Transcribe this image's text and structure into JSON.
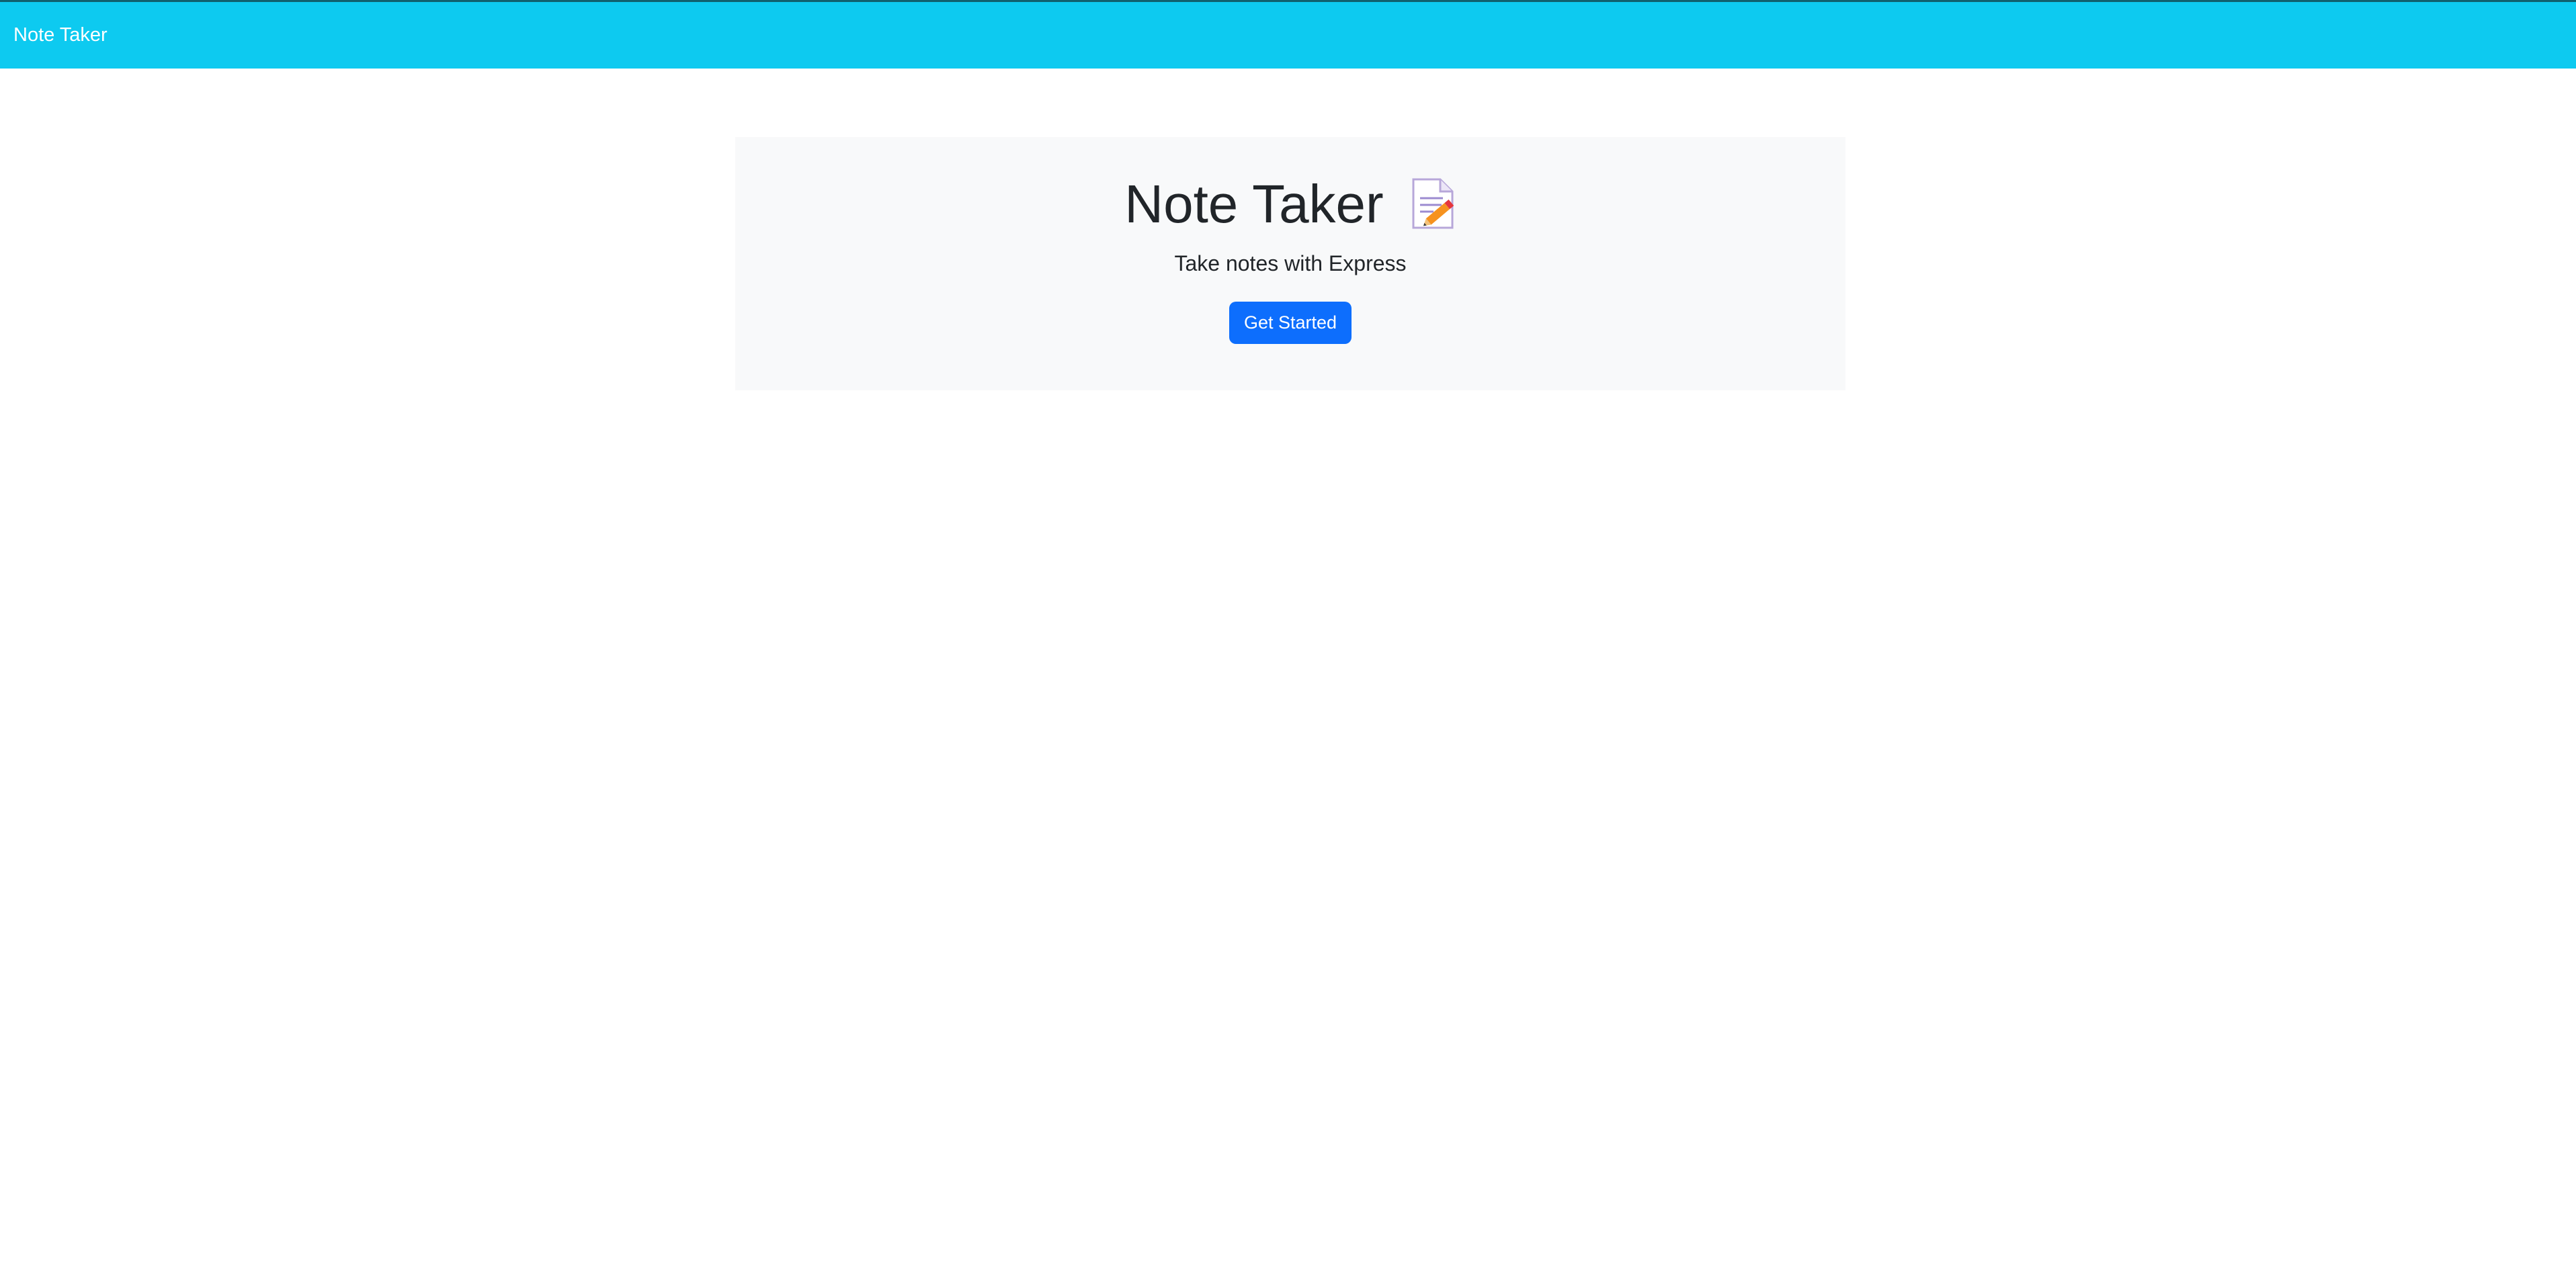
{
  "navbar": {
    "brand": "Note Taker"
  },
  "hero": {
    "title": "Note Taker",
    "icon": "memo-icon",
    "subtitle": "Take notes with Express",
    "cta_label": "Get Started"
  },
  "colors": {
    "navbar": "#0dcaf0",
    "primary_button": "#0d6efd",
    "jumbotron": "#f8f9fa"
  }
}
